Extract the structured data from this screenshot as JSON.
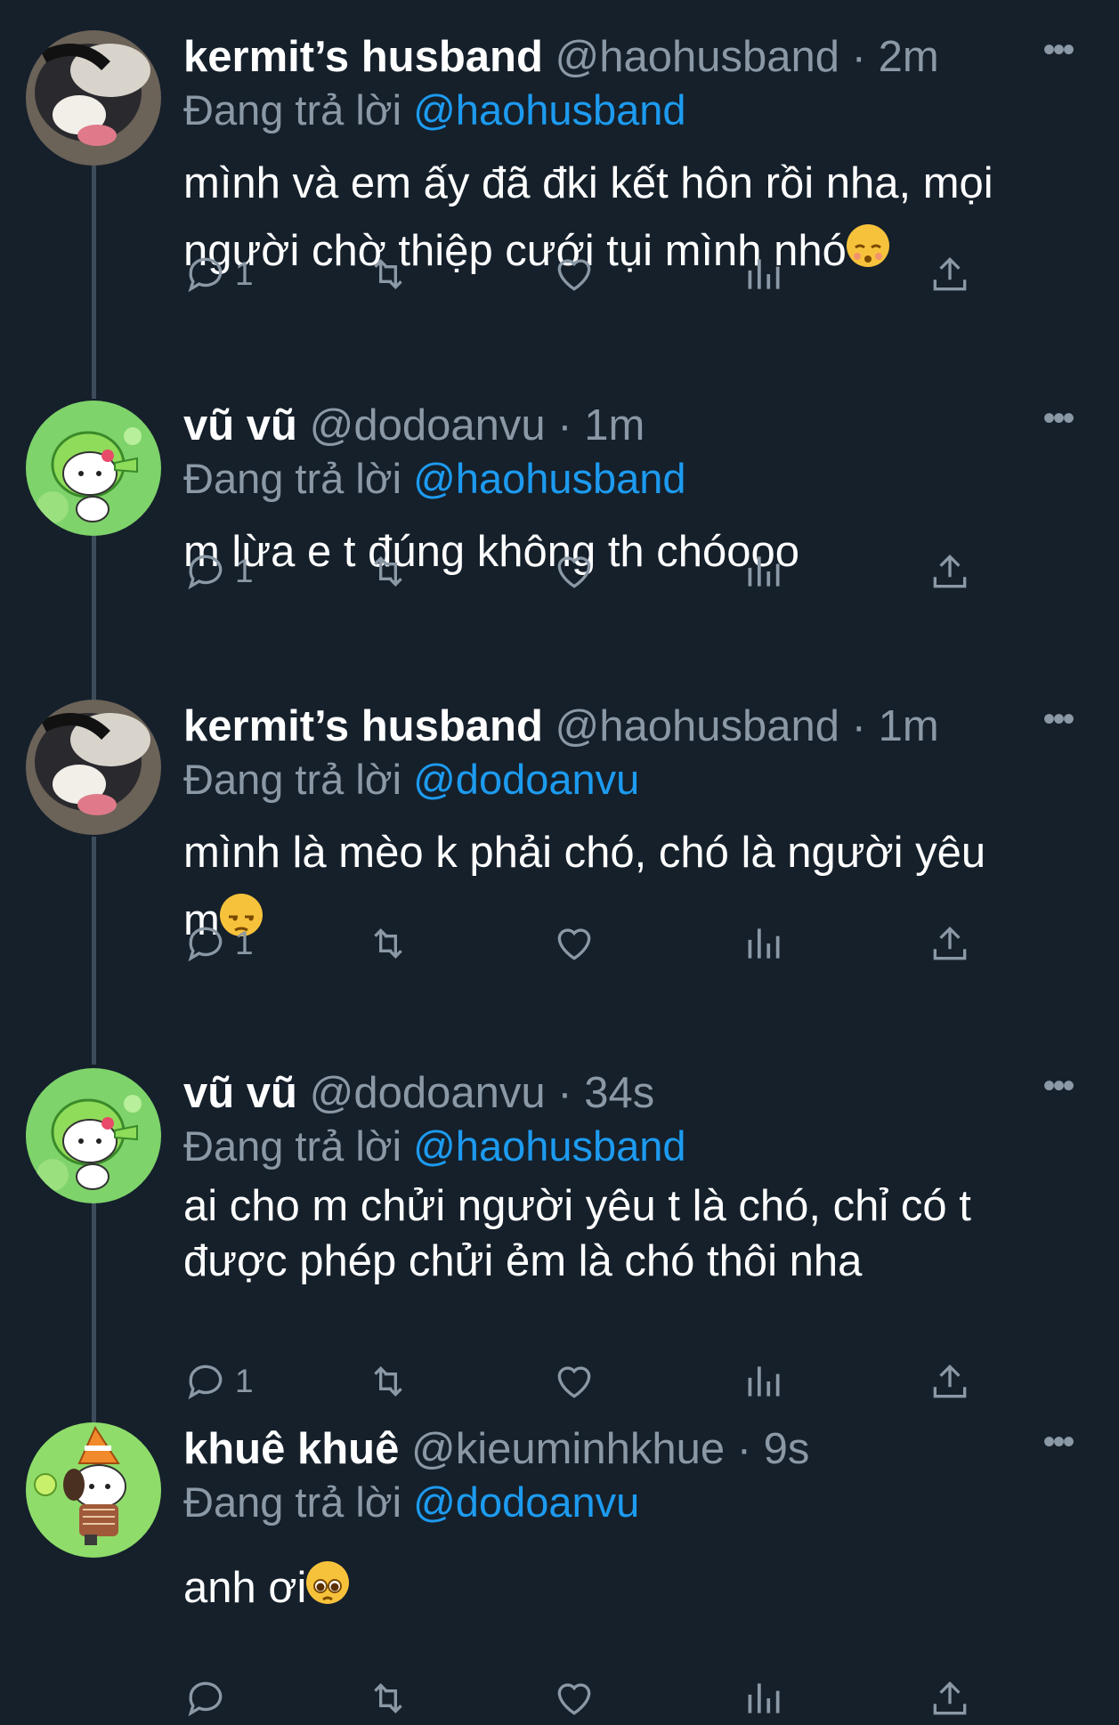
{
  "tweets": [
    {
      "name": "kermit’s husband",
      "handle": "@haohusband",
      "dot": "·",
      "time": "2m",
      "replying_prefix": "Đang trả lời",
      "replying_to": "@haohusband",
      "text_lines": [
        "mình và em ấy đã đki kết hôn rồi nha, mọi",
        "người chờ thiệp cưới tụi mình nhó"
      ],
      "emoji": "kissing-face-closed-eyes",
      "reply_count": "1",
      "avatar": "cat-blurry-photo"
    },
    {
      "name": "vũ vũ",
      "handle": "@dodoanvu",
      "dot": "·",
      "time": "1m",
      "replying_prefix": "Đang trả lời",
      "replying_to": "@haohusband",
      "text_lines": [
        "m lừa e t đúng không th chóooo"
      ],
      "emoji": "",
      "reply_count": "1",
      "avatar": "hello-kitty-peashooter"
    },
    {
      "name": "kermit’s husband",
      "handle": "@haohusband",
      "dot": "·",
      "time": "1m",
      "replying_prefix": "Đang trả lời",
      "replying_to": "@dodoanvu",
      "text_lines": [
        "mình là mèo k phải chó, chó là người yêu",
        "m"
      ],
      "emoji": "unamused-face",
      "reply_count": "1",
      "avatar": "cat-blurry-photo"
    },
    {
      "name": "vũ vũ",
      "handle": "@dodoanvu",
      "dot": "·",
      "time": "34s",
      "replying_prefix": "Đang trả lời",
      "replying_to": "@haohusband",
      "text_lines": [
        "ai cho m chửi người yêu t là chó, chỉ có t",
        "được phép chửi ẻm là chó thôi nha"
      ],
      "emoji": "",
      "reply_count": "1",
      "avatar": "hello-kitty-peashooter"
    },
    {
      "name": "khuê khuê",
      "handle": "@kieuminhkhue",
      "dot": "·",
      "time": "9s",
      "replying_prefix": "Đang trả lời",
      "replying_to": "@dodoanvu",
      "text_lines": [
        "anh ơi"
      ],
      "emoji": "pleading-face",
      "reply_count": "",
      "avatar": "pochacco-traffic-cone"
    }
  ],
  "icons": {
    "reply": "reply-icon",
    "retweet": "retweet-icon",
    "like": "like-icon",
    "views": "views-icon",
    "share": "share-icon",
    "more": "more-icon"
  },
  "colors": {
    "background": "#15202b",
    "mention": "#1d9bf0",
    "secondary_text": "#8b98a5",
    "thread_line": "#3d4c5b"
  }
}
